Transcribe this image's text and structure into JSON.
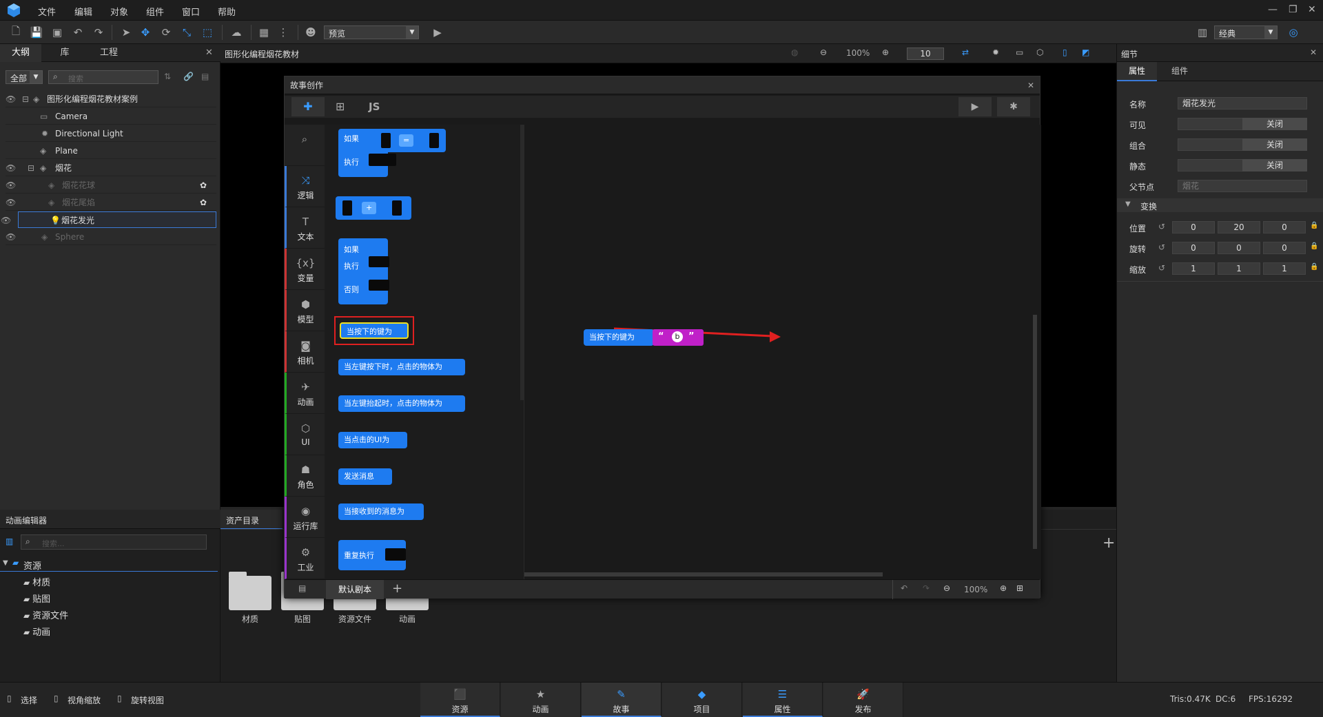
{
  "menubar": {
    "items": [
      "文件",
      "编辑",
      "对象",
      "组件",
      "窗口",
      "帮助"
    ]
  },
  "toolbar": {
    "preview_select": "预览",
    "layout_select": "经典"
  },
  "left_panel": {
    "tabs": [
      "大纲",
      "库",
      "工程"
    ],
    "filter": "全部",
    "search_placeholder": "搜索",
    "tree": [
      {
        "label": "图形化编程烟花教材案例"
      },
      {
        "label": "Camera"
      },
      {
        "label": "Directional Light"
      },
      {
        "label": "Plane"
      },
      {
        "label": "烟花"
      },
      {
        "label": "烟花花球"
      },
      {
        "label": "烟花尾焰"
      },
      {
        "label": "烟花发光"
      },
      {
        "label": "Sphere"
      }
    ]
  },
  "viewport_header": {
    "title": "图形化编程烟花教材",
    "zoom": "100%",
    "grid_value": "10"
  },
  "dialog": {
    "title": "故事创作",
    "js_tab": "JS",
    "categories": [
      "逻辑",
      "文本",
      "变量",
      "模型",
      "相机",
      "动画",
      "UI",
      "角色",
      "运行库",
      "工业"
    ],
    "flyout_blocks": {
      "if1": "如果",
      "do1": "执行",
      "op_eq": "=",
      "op_plus": "+",
      "if2": "如果",
      "do2": "执行",
      "else2": "否则",
      "key_press": "当按下的键为",
      "left_down": "当左键按下时，点击的物体为",
      "left_up": "当左键抬起时，点击的物体为",
      "ui_click": "当点击的UI为",
      "send_msg": "发送消息",
      "recv_msg": "当接收到的消息为",
      "repeat": "重复执行"
    },
    "workspace_block": {
      "label": "当按下的键为",
      "key": "b",
      "open_quote": "“",
      "close_quote": "”"
    },
    "bottom": {
      "script_tab": "默认剧本",
      "zoom": "100%"
    }
  },
  "right_panel": {
    "title": "细节",
    "tabs": [
      "属性",
      "组件"
    ],
    "name_label": "名称",
    "name_value": "烟花发光",
    "visible_label": "可见",
    "visible_btn": "关闭",
    "group_label": "组合",
    "group_btn": "关闭",
    "static_label": "静态",
    "static_btn": "关闭",
    "parent_label": "父节点",
    "parent_value": "烟花",
    "transform_label": "变换",
    "position_label": "位置",
    "position": [
      "0",
      "20",
      "0"
    ],
    "rotation_label": "旋转",
    "rotation": [
      "0",
      "0",
      "0"
    ],
    "scale_label": "缩放",
    "scale": [
      "1",
      "1",
      "1"
    ]
  },
  "anim_panel": {
    "title": "动画编辑器",
    "search_placeholder": "搜索...",
    "root": "资源",
    "folders": [
      "材质",
      "贴图",
      "资源文件",
      "动画"
    ]
  },
  "asset_panel": {
    "title": "资产目录",
    "items": [
      "材质",
      "贴图",
      "资源文件",
      "动画"
    ]
  },
  "statusbar": {
    "left": [
      "选择",
      "视角缩放",
      "旋转视图"
    ],
    "tabs": [
      "资源",
      "动画",
      "故事",
      "项目",
      "属性",
      "发布"
    ],
    "tris": "Tris:0.47K",
    "dc": "DC:6",
    "fps": "FPS:16292"
  }
}
